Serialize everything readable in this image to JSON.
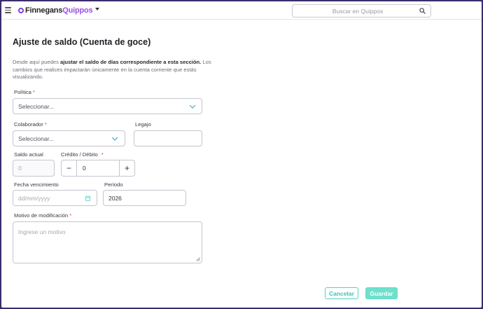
{
  "header": {
    "logo_part1": "Finnegans",
    "logo_part2": "Quippos",
    "search_placeholder": "Buscar en Quippos"
  },
  "page": {
    "title": "Ajuste de saldo (Cuenta de goce)",
    "desc_prefix": "Desde aquí puedes ",
    "desc_bold": "ajustar el saldo de días correspondiente a esta sección.",
    "desc_rest": " Los cambios que realices impactarán únicamente en la cuenta corriente que estás visualizando."
  },
  "form": {
    "politica": {
      "label": "Política",
      "required": "*",
      "value": "Seleccionar..."
    },
    "colaborador": {
      "label": "Colaborador",
      "required": "*",
      "value": "Seleccionar..."
    },
    "legajo": {
      "label": "Legajo",
      "value": ""
    },
    "saldo_actual": {
      "label": "Saldo actual",
      "value": "0"
    },
    "credito_debito": {
      "label": "Crédito / Débito",
      "required": "*",
      "value": "0",
      "minus": "−",
      "plus": "+"
    },
    "fecha_vencimiento": {
      "label": "Fecha vencimiento",
      "placeholder": "dd/mm/yyyy"
    },
    "periodo": {
      "label": "Período",
      "value": "2026"
    },
    "motivo": {
      "label": "Motivo de modificación",
      "required": "*",
      "placeholder": "Ingrese un motivo"
    }
  },
  "actions": {
    "cancel_label": "Cancelar",
    "save_label": "Guardar"
  },
  "colors": {
    "brand": "#9c4ee8",
    "accent": "#4fd1c5",
    "chevron": "#2aa6c9"
  }
}
